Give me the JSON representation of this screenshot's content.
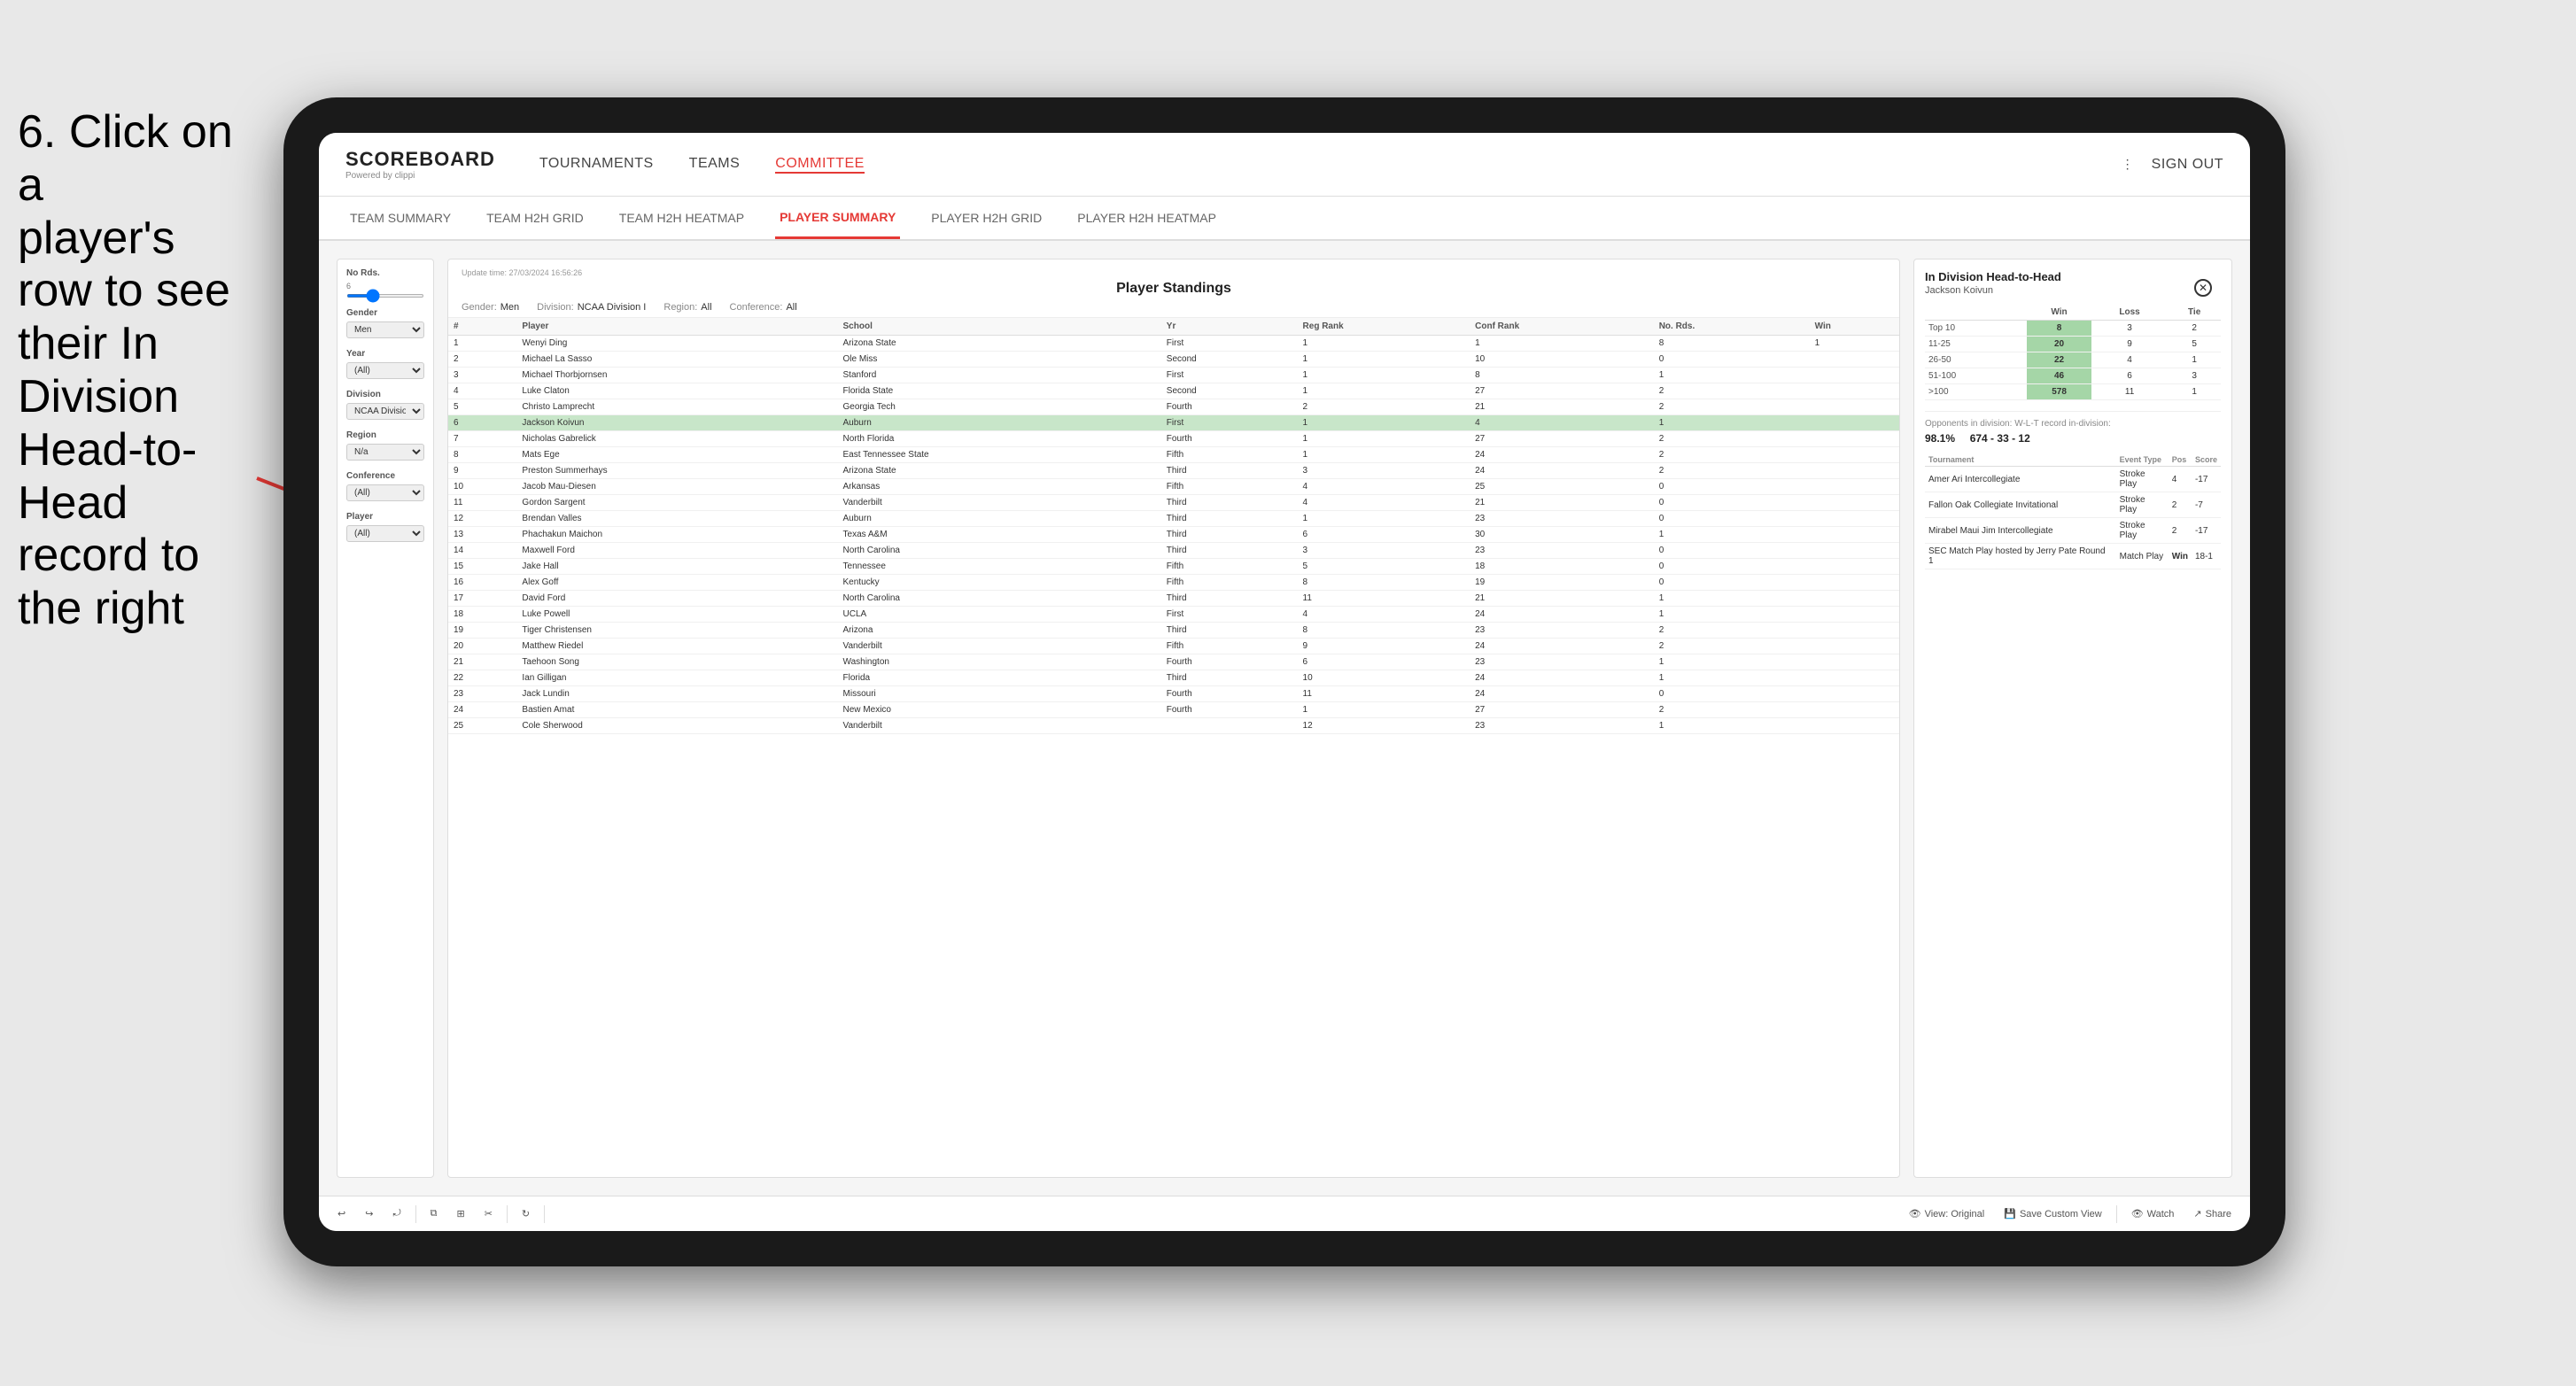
{
  "instruction": {
    "line1": "6. Click on a",
    "line2": "player's row to see",
    "line3": "their In Division",
    "line4": "Head-to-Head",
    "line5": "record to the right"
  },
  "nav": {
    "logo_title": "SCOREBOARD",
    "logo_subtitle": "Powered by clippi",
    "links": [
      "TOURNAMENTS",
      "TEAMS",
      "COMMITTEE"
    ],
    "sign_out": "Sign out"
  },
  "sub_nav": {
    "links": [
      "TEAM SUMMARY",
      "TEAM H2H GRID",
      "TEAM H2H HEATMAP",
      "PLAYER SUMMARY",
      "PLAYER H2H GRID",
      "PLAYER H2H HEATMAP"
    ],
    "active": "PLAYER SUMMARY"
  },
  "standings": {
    "update_time": "Update time:",
    "update_date": "27/03/2024 16:56:26",
    "title": "Player Standings",
    "gender_label": "Gender:",
    "gender_value": "Men",
    "division_label": "Division:",
    "division_value": "NCAA Division I",
    "region_label": "Region:",
    "region_value": "All",
    "conference_label": "Conference:",
    "conference_value": "All",
    "columns": [
      "#",
      "Player",
      "School",
      "Yr",
      "Reg Rank",
      "Conf Rank",
      "No. Rds.",
      "Win"
    ],
    "rows": [
      {
        "num": "1",
        "player": "Wenyi Ding",
        "school": "Arizona State",
        "yr": "First",
        "reg": "1",
        "conf": "1",
        "rds": "8",
        "win": "1"
      },
      {
        "num": "2",
        "player": "Michael La Sasso",
        "school": "Ole Miss",
        "yr": "Second",
        "reg": "1",
        "conf": "10",
        "rds": "0",
        "win": ""
      },
      {
        "num": "3",
        "player": "Michael Thorbjornsen",
        "school": "Stanford",
        "yr": "First",
        "reg": "1",
        "conf": "8",
        "rds": "1",
        "win": ""
      },
      {
        "num": "4",
        "player": "Luke Claton",
        "school": "Florida State",
        "yr": "Second",
        "reg": "1",
        "conf": "27",
        "rds": "2",
        "win": ""
      },
      {
        "num": "5",
        "player": "Christo Lamprecht",
        "school": "Georgia Tech",
        "yr": "Fourth",
        "reg": "2",
        "conf": "21",
        "rds": "2",
        "win": ""
      },
      {
        "num": "6",
        "player": "Jackson Koivun",
        "school": "Auburn",
        "yr": "First",
        "reg": "1",
        "conf": "4",
        "rds": "1",
        "win": "",
        "highlighted": true
      },
      {
        "num": "7",
        "player": "Nicholas Gabrelick",
        "school": "North Florida",
        "yr": "Fourth",
        "reg": "1",
        "conf": "27",
        "rds": "2",
        "win": ""
      },
      {
        "num": "8",
        "player": "Mats Ege",
        "school": "East Tennessee State",
        "yr": "Fifth",
        "reg": "1",
        "conf": "24",
        "rds": "2",
        "win": ""
      },
      {
        "num": "9",
        "player": "Preston Summerhays",
        "school": "Arizona State",
        "yr": "Third",
        "reg": "3",
        "conf": "24",
        "rds": "2",
        "win": ""
      },
      {
        "num": "10",
        "player": "Jacob Mau-Diesen",
        "school": "Arkansas",
        "yr": "Fifth",
        "reg": "4",
        "conf": "25",
        "rds": "0",
        "win": ""
      },
      {
        "num": "11",
        "player": "Gordon Sargent",
        "school": "Vanderbilt",
        "yr": "Third",
        "reg": "4",
        "conf": "21",
        "rds": "0",
        "win": ""
      },
      {
        "num": "12",
        "player": "Brendan Valles",
        "school": "Auburn",
        "yr": "Third",
        "reg": "1",
        "conf": "23",
        "rds": "0",
        "win": ""
      },
      {
        "num": "13",
        "player": "Phachakun Maichon",
        "school": "Texas A&M",
        "yr": "Third",
        "reg": "6",
        "conf": "30",
        "rds": "1",
        "win": ""
      },
      {
        "num": "14",
        "player": "Maxwell Ford",
        "school": "North Carolina",
        "yr": "Third",
        "reg": "3",
        "conf": "23",
        "rds": "0",
        "win": ""
      },
      {
        "num": "15",
        "player": "Jake Hall",
        "school": "Tennessee",
        "yr": "Fifth",
        "reg": "5",
        "conf": "18",
        "rds": "0",
        "win": ""
      },
      {
        "num": "16",
        "player": "Alex Goff",
        "school": "Kentucky",
        "yr": "Fifth",
        "reg": "8",
        "conf": "19",
        "rds": "0",
        "win": ""
      },
      {
        "num": "17",
        "player": "David Ford",
        "school": "North Carolina",
        "yr": "Third",
        "reg": "11",
        "conf": "21",
        "rds": "1",
        "win": ""
      },
      {
        "num": "18",
        "player": "Luke Powell",
        "school": "UCLA",
        "yr": "First",
        "reg": "4",
        "conf": "24",
        "rds": "1",
        "win": ""
      },
      {
        "num": "19",
        "player": "Tiger Christensen",
        "school": "Arizona",
        "yr": "Third",
        "reg": "8",
        "conf": "23",
        "rds": "2",
        "win": ""
      },
      {
        "num": "20",
        "player": "Matthew Riedel",
        "school": "Vanderbilt",
        "yr": "Fifth",
        "reg": "9",
        "conf": "24",
        "rds": "2",
        "win": ""
      },
      {
        "num": "21",
        "player": "Taehoon Song",
        "school": "Washington",
        "yr": "Fourth",
        "reg": "6",
        "conf": "23",
        "rds": "1",
        "win": ""
      },
      {
        "num": "22",
        "player": "Ian Gilligan",
        "school": "Florida",
        "yr": "Third",
        "reg": "10",
        "conf": "24",
        "rds": "1",
        "win": ""
      },
      {
        "num": "23",
        "player": "Jack Lundin",
        "school": "Missouri",
        "yr": "Fourth",
        "reg": "11",
        "conf": "24",
        "rds": "0",
        "win": ""
      },
      {
        "num": "24",
        "player": "Bastien Amat",
        "school": "New Mexico",
        "yr": "Fourth",
        "reg": "1",
        "conf": "27",
        "rds": "2",
        "win": ""
      },
      {
        "num": "25",
        "player": "Cole Sherwood",
        "school": "Vanderbilt",
        "yr": "",
        "reg": "12",
        "conf": "23",
        "rds": "1",
        "win": ""
      }
    ]
  },
  "filters": {
    "no_rds_label": "No Rds.",
    "no_rds_min": "6",
    "gender_label": "Gender",
    "gender_value": "Men",
    "year_label": "Year",
    "year_value": "(All)",
    "division_label": "Division",
    "division_value": "NCAA Division I",
    "region_label": "Region",
    "region_value": "N/a",
    "conference_label": "Conference",
    "conference_value": "(All)",
    "player_label": "Player",
    "player_value": "(All)"
  },
  "h2h": {
    "title": "In Division Head-to-Head",
    "player_name": "Jackson Koivun",
    "columns": [
      "Win",
      "Loss",
      "Tie"
    ],
    "rows": [
      {
        "label": "Top 10",
        "win": "8",
        "loss": "3",
        "tie": "2"
      },
      {
        "label": "11-25",
        "win": "20",
        "loss": "9",
        "tie": "5"
      },
      {
        "label": "26-50",
        "win": "22",
        "loss": "4",
        "tie": "1"
      },
      {
        "label": "51-100",
        "win": "46",
        "loss": "6",
        "tie": "3"
      },
      {
        "label": ">100",
        "win": "578",
        "loss": "11",
        "tie": "1"
      }
    ],
    "opponents_label": "Opponents in division:",
    "opponents_pct": "98.1%",
    "wlt_label": "W-L-T record in-division:",
    "wlt_record": "674 - 33 - 12",
    "tournament_cols": [
      "Tournament",
      "Event Type",
      "Pos",
      "Score"
    ],
    "tournaments": [
      {
        "name": "Amer Ari Intercollegiate",
        "type": "Stroke Play",
        "pos": "4",
        "score": "-17"
      },
      {
        "name": "Fallon Oak Collegiate Invitational",
        "type": "Stroke Play",
        "pos": "2",
        "score": "-7"
      },
      {
        "name": "Mirabel Maui Jim Intercollegiate",
        "type": "Stroke Play",
        "pos": "2",
        "score": "-17"
      },
      {
        "name": "SEC Match Play hosted by Jerry Pate Round 1",
        "type": "Match Play",
        "pos": "Win",
        "score": "18-1"
      }
    ]
  },
  "toolbar": {
    "view_original": "View: Original",
    "save_custom": "Save Custom View",
    "watch": "Watch",
    "share": "Share"
  }
}
